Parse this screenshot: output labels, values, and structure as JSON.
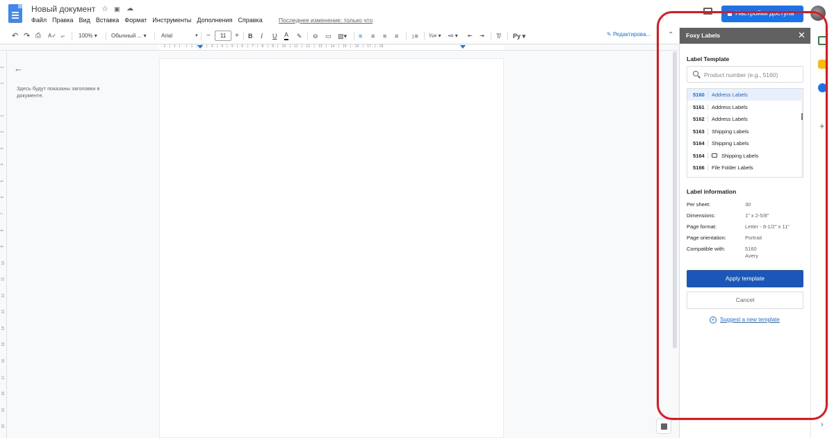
{
  "doc": {
    "title": "Новый документ",
    "last_edit": "Последнее изменение: только что",
    "share_label": "Настройки доступа"
  },
  "menu": [
    "Файл",
    "Правка",
    "Вид",
    "Вставка",
    "Формат",
    "Инструменты",
    "Дополнения",
    "Справка"
  ],
  "toolbar": {
    "zoom": "100%",
    "style": "Обычный ...",
    "font": "Arial",
    "font_size": "11",
    "editing_mode": "Редактирова..."
  },
  "ruler": {
    "numbers": "· 2 · | · 1 · | ·   · | · 1 · | · 2 · | · 3 · | · 4 · | · 5 · | · 6 · | · 7 · | · 8 · | · 9 · | · 10 · | · 11 · | · 12 · | · 13 · | · 14 · | · 15 · | · 16 · | · 17 · | · 18 ·"
  },
  "vruler": [
    "2",
    "1",
    "1",
    "2",
    "3",
    "4",
    "5",
    "6",
    "7",
    "8",
    "9",
    "10",
    "11",
    "12",
    "13",
    "14",
    "15",
    "16",
    "17",
    "18",
    "19",
    "20"
  ],
  "outline": {
    "text": "Здесь будут показаны заголовки в документе."
  },
  "sidebar": {
    "title": "Foxy Labels",
    "label_template_heading": "Label Template",
    "search_placeholder": "Product number (e.g., 5160)",
    "templates": [
      {
        "number": "5160",
        "name": "Address Labels",
        "selected": true,
        "icon": ""
      },
      {
        "number": "5161",
        "name": "Address Labels",
        "selected": false,
        "icon": ""
      },
      {
        "number": "5162",
        "name": "Address Labels",
        "selected": false,
        "icon": ""
      },
      {
        "number": "5163",
        "name": "Shipping Labels",
        "selected": false,
        "icon": ""
      },
      {
        "number": "5164",
        "name": "Shipping Labels",
        "selected": false,
        "icon": ""
      },
      {
        "number": "5164",
        "name": "Shipping Labels",
        "selected": false,
        "icon": "label-outline-icon"
      },
      {
        "number": "5166",
        "name": "File Folder Labels",
        "selected": false,
        "icon": ""
      }
    ],
    "label_info_heading": "Label information",
    "info": [
      {
        "key": "Per sheet:",
        "value": "30"
      },
      {
        "key": "Dimensions:",
        "value": "1\" x 2-5/8\""
      },
      {
        "key": "Page format:",
        "value": "Letter - 8-1/2\" x 11\""
      },
      {
        "key": "Page orientation:",
        "value": "Portrait"
      },
      {
        "key": "Compatible with:",
        "value": "5160",
        "value2": "Avery"
      }
    ],
    "apply_label": "Apply template",
    "cancel_label": "Cancel",
    "suggest_label": "Suggest a new template"
  },
  "colors": {
    "accent": "#1a73e8",
    "apply_button": "#1a57b8",
    "sidebar_header": "#616161",
    "highlight": "#e8141c"
  }
}
